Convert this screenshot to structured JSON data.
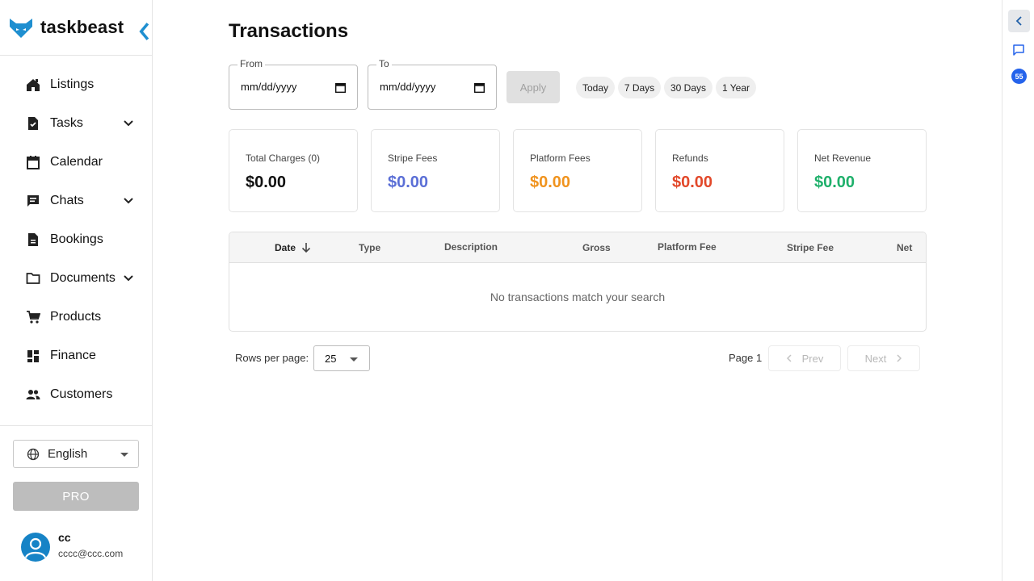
{
  "brand": {
    "name": "taskbeast",
    "accent": "#1f8fd0"
  },
  "sidebar": {
    "items": [
      {
        "label": "Listings",
        "icon": "home-icon",
        "expandable": false
      },
      {
        "label": "Tasks",
        "icon": "task-icon",
        "expandable": true
      },
      {
        "label": "Calendar",
        "icon": "calendar-icon",
        "expandable": false
      },
      {
        "label": "Chats",
        "icon": "chat-icon",
        "expandable": true
      },
      {
        "label": "Bookings",
        "icon": "document-icon",
        "expandable": false
      },
      {
        "label": "Documents",
        "icon": "folder-icon",
        "expandable": true
      },
      {
        "label": "Products",
        "icon": "cart-icon",
        "expandable": false
      },
      {
        "label": "Finance",
        "icon": "dashboard-icon",
        "expandable": false
      },
      {
        "label": "Customers",
        "icon": "people-icon",
        "expandable": false
      }
    ],
    "language": "English",
    "pro_label": "PRO",
    "user": {
      "name": "cc",
      "email": "cccc@ccc.com"
    }
  },
  "rail": {
    "badge": "55"
  },
  "main": {
    "title": "Transactions",
    "from": {
      "label": "From",
      "value": "mm/dd/yyyy"
    },
    "to": {
      "label": "To",
      "value": "mm/dd/yyyy"
    },
    "apply_label": "Apply",
    "chips": [
      "Today",
      "7 Days",
      "30 Days",
      "1 Year"
    ],
    "cards": [
      {
        "label": "Total Charges (0)",
        "value": "$0.00",
        "color": "#111111"
      },
      {
        "label": "Stripe Fees",
        "value": "$0.00",
        "color": "#5b6fd6"
      },
      {
        "label": "Platform Fees",
        "value": "$0.00",
        "color": "#f0931e"
      },
      {
        "label": "Refunds",
        "value": "$0.00",
        "color": "#e2482a"
      },
      {
        "label": "Net Revenue",
        "value": "$0.00",
        "color": "#1fb06b"
      }
    ],
    "table": {
      "columns": [
        "Date",
        "Type",
        "Description",
        "Gross",
        "Platform Fee",
        "Stripe Fee",
        "Net"
      ],
      "empty_text": "No transactions match your search"
    },
    "pagination": {
      "rows_label": "Rows per page:",
      "rows_value": "25",
      "page_label": "Page 1",
      "prev_label": "Prev",
      "next_label": "Next"
    }
  }
}
